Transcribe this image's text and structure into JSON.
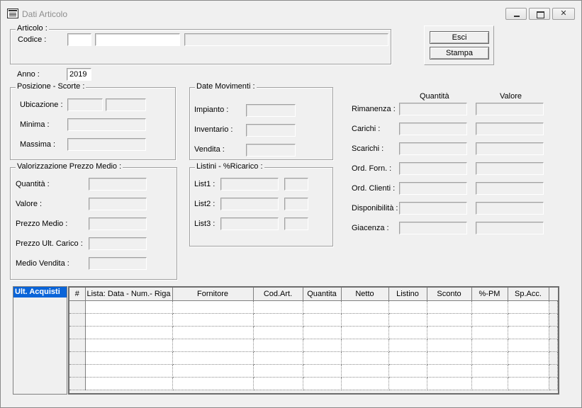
{
  "window": {
    "title": "Dati Articolo",
    "controls": {
      "minimize": "minimize",
      "maximize": "maximize",
      "close": "✕"
    }
  },
  "articolo": {
    "group_label": "Articolo :",
    "codice_label": "Codice :"
  },
  "buttons": {
    "esci": "Esci",
    "stampa": "Stampa"
  },
  "anno": {
    "label": "Anno :",
    "value": "2019"
  },
  "posizione": {
    "group_label": "Posizione - Scorte :",
    "ubicazione": "Ubicazione :",
    "minima": "Minima :",
    "massima": "Massima :"
  },
  "date_movimenti": {
    "group_label": "Date Movimenti :",
    "impianto": "Impianto :",
    "inventario": "Inventario :",
    "vendita": "Vendita :"
  },
  "valorizzazione": {
    "group_label": "Valorizzazione Prezzo Medio :",
    "quantita": "Quantità :",
    "valore": "Valore :",
    "prezzo_medio": "Prezzo Medio :",
    "prezzo_ult_carico": "Prezzo Ult. Carico :",
    "medio_vendita": "Medio Vendita :"
  },
  "listini": {
    "group_label": "Listini - %Ricarico :",
    "list1": "List1 :",
    "list2": "List2 :",
    "list3": "List3 :"
  },
  "totali": {
    "col_quantita": "Quantità",
    "col_valore": "Valore",
    "rows": [
      "Rimanenza :",
      "Carichi :",
      "Scarichi :",
      "Ord. Forn. :",
      "Ord. Clienti :",
      "Disponibilità :",
      "Giacenza :"
    ]
  },
  "ult_acquisti": {
    "tab_label": "Ult. Acquisti",
    "columns": [
      "#",
      "Lista: Data - Num.- Riga",
      "Fornitore",
      "Cod.Art.",
      "Quantita",
      "Netto",
      "Listino",
      "Sconto",
      "%-PM",
      "Sp.Acc."
    ]
  },
  "colors": {
    "selection": "#0a64d8",
    "window_bg": "#f0f0f0"
  }
}
